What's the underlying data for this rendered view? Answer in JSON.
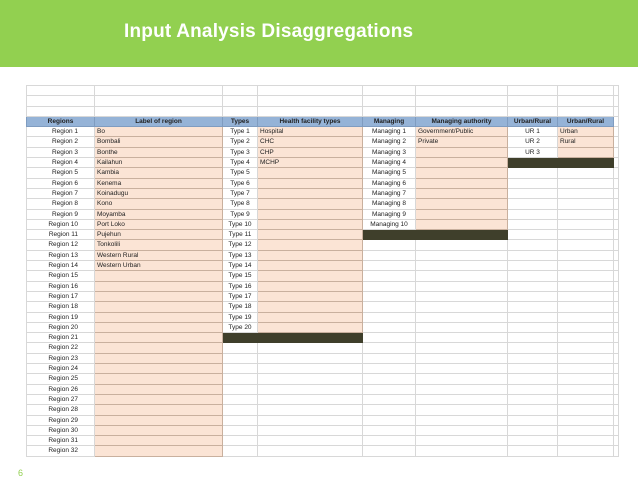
{
  "title": "Input Analysis Disaggregations",
  "page_number": "6",
  "headers": [
    "Regions",
    "Label of region",
    "Types",
    "Health facility types",
    "Managing",
    "Managing authority",
    "Urban/Rural",
    "Urban/Rural"
  ],
  "regions": [
    "Region 1",
    "Region 2",
    "Region 3",
    "Region 4",
    "Region 5",
    "Region 6",
    "Region 7",
    "Region 8",
    "Region 9",
    "Region 10",
    "Region 11",
    "Region 12",
    "Region 13",
    "Region 14",
    "Region 15",
    "Region 16",
    "Region 17",
    "Region 18",
    "Region 19",
    "Region 20",
    "Region 21",
    "Region 22",
    "Region 23",
    "Region 24",
    "Region 25",
    "Region 26",
    "Region 27",
    "Region 28",
    "Region 29",
    "Region 30",
    "Region 31",
    "Region 32"
  ],
  "region_labels": [
    "Bo",
    "Bombali",
    "Bonthe",
    "Kailahun",
    "Kambia",
    "Kenema",
    "Koinadugu",
    "Kono",
    "Moyamba",
    "Port Loko",
    "Pujehun",
    "Tonkolili",
    "Western Rural",
    "Western Urban"
  ],
  "types": [
    "Type 1",
    "Type 2",
    "Type 3",
    "Type 4",
    "Type 5",
    "Type 6",
    "Type 7",
    "Type 8",
    "Type 9",
    "Type 10",
    "Type 11",
    "Type 12",
    "Type 13",
    "Type 14",
    "Type 15",
    "Type 16",
    "Type 17",
    "Type 18",
    "Type 19",
    "Type 20"
  ],
  "facility_types": [
    "Hospital",
    "CHC",
    "CHP",
    "MCHP"
  ],
  "managing": [
    "Managing 1",
    "Managing 2",
    "Managing 3",
    "Managing 4",
    "Managing 5",
    "Managing 6",
    "Managing 7",
    "Managing 8",
    "Managing 9",
    "Managing 10"
  ],
  "managing_authority": [
    "Government/Public",
    "Private"
  ],
  "ur_codes": [
    "UR 1",
    "UR 2",
    "UR 3"
  ],
  "ur_labels": [
    "Urban",
    "Rural"
  ],
  "colors": {
    "banner": "#92d050",
    "header": "#95b3d7",
    "input_cell": "#fbe4d5",
    "end_marker": "#3f3f2b"
  }
}
